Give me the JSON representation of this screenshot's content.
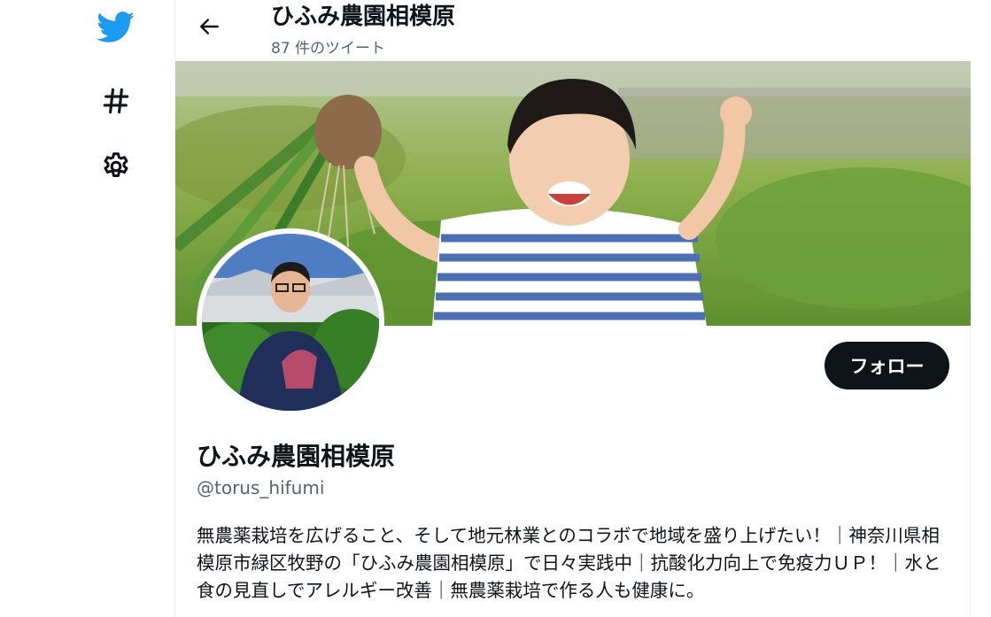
{
  "nav": {
    "logo_icon": "twitter-bird-icon",
    "explore_icon": "hashtag-icon",
    "settings_icon": "gear-icon",
    "brand_color": "#1d9bf0"
  },
  "header": {
    "title": "ひふみ農園相模原",
    "tweet_count": "87 件のツイート"
  },
  "profile": {
    "follow_label": "フォロー",
    "name": "ひふみ農園相模原",
    "handle": "@torus_hifumi",
    "bio": "無農薬栽培を広げること、そして地元林業とのコラボで地域を盛り上げたい！｜神奈川県相模原市緑区牧野の「ひふみ農園相模原」で日々実践中｜抗酸化力向上で免疫力ＵＰ！｜水と食の見直しでアレルギー改善｜無農薬栽培で作る人も健康に。"
  }
}
